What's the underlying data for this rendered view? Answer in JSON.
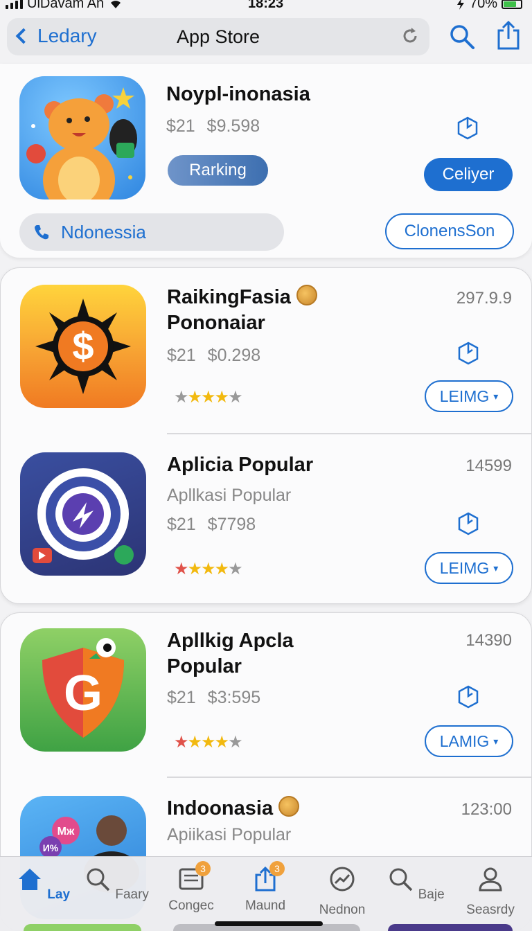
{
  "status_bar": {
    "carrier": "UiDavam An",
    "time": "18:23",
    "battery": "70%"
  },
  "navbar": {
    "back_label": "Ledary",
    "title": "App Store",
    "reload_icon": "reload-icon",
    "search_icon": "search-icon",
    "share_icon": "share-icon"
  },
  "featured": {
    "name": "Noypl-inonasia",
    "price_a": "$21",
    "price_b": "$9.598",
    "ranking_label": "Rarking",
    "deliver_label": "Celiyer",
    "phone_label": "Ndonessia",
    "outline_label": "ClonensSon"
  },
  "apps": [
    {
      "name": "RaikingFasia",
      "name_line2": "Pononaiar",
      "subtitle": "",
      "price_a": "$21",
      "price_b": "$0.298",
      "count": "297.9.9",
      "button": "LEIMG",
      "rating": 4,
      "first_star": "grey"
    },
    {
      "name": "Aplicia Popular",
      "name_line2": "",
      "subtitle": "Apllkasi Popular",
      "price_a": "$21",
      "price_b": "$7798",
      "count": "14599",
      "button": "LEIMG",
      "rating": 4,
      "first_star": "red"
    },
    {
      "name": "Apllkig Apcla",
      "name_line2": "Popular",
      "subtitle": "",
      "price_a": "$21",
      "price_b": "$3:595",
      "count": "14390",
      "button": "LAMIG",
      "rating": 4,
      "first_star": "red"
    },
    {
      "name": "Indoonasia",
      "name_line2": "",
      "subtitle": "Apiikasi Popular",
      "price_a": "",
      "price_b": "",
      "count": "123:00",
      "button": "",
      "rating": 0,
      "first_star": ""
    }
  ],
  "app4_icon_text": {
    "bubble_a": "Mж",
    "bubble_b": "И%"
  },
  "tabs": [
    {
      "label": "Lay",
      "icon": "home-icon",
      "active": true
    },
    {
      "label": "Faary",
      "icon": "search-icon"
    },
    {
      "label": "Congec",
      "icon": "list-icon",
      "badge": "3"
    },
    {
      "label": "Maund",
      "icon": "share-icon",
      "badge": "3"
    },
    {
      "label": "Nednon",
      "icon": "trend-icon"
    },
    {
      "label": "Baje",
      "icon": "magnifier-icon"
    },
    {
      "label": "Seasrdy",
      "icon": "person-icon"
    }
  ],
  "colors": {
    "accent": "#1e6fd0",
    "badge": "#f0a13c",
    "star_yellow": "#f2b90f",
    "star_red": "#e0524a"
  }
}
